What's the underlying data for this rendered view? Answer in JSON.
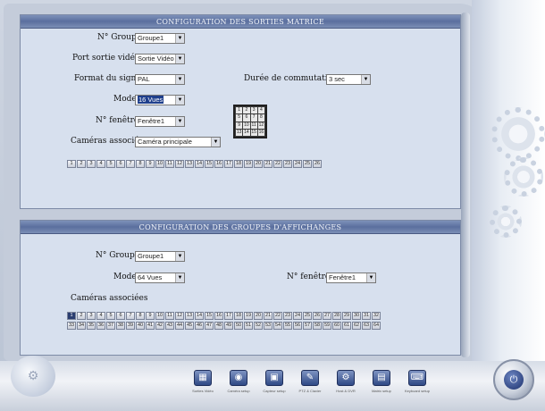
{
  "matrix": {
    "title": "CONFIGURATION DES SORTIES MATRICE",
    "groupe_label": "N° Groupe",
    "groupe_value": "Groupe1",
    "port_label": "Port sortie vidéo",
    "port_value": "Sortie Vidéo",
    "format_label": "Format du signal",
    "format_value": "PAL",
    "duree_label": "Durée de commutation",
    "duree_value": "3 sec",
    "mode_label": "Mode",
    "mode_value": "16 Vues",
    "fenetre_label": "N° fenêtre",
    "fenetre_value": "Fenêtre1",
    "cameras_label": "Caméras associées",
    "cameras_value": "Caméra principale",
    "camera_numbers": [
      "1",
      "2",
      "3",
      "4",
      "5",
      "6",
      "7",
      "8",
      "9",
      "10",
      "11",
      "12",
      "13",
      "14",
      "15",
      "16",
      "17",
      "18",
      "19",
      "20",
      "21",
      "22",
      "23",
      "24",
      "25",
      "26"
    ],
    "layout_cells": [
      "1",
      "2",
      "3",
      "4",
      "5",
      "6",
      "7",
      "8",
      "9",
      "10",
      "11",
      "12",
      "13",
      "14",
      "15",
      "16"
    ]
  },
  "groups": {
    "title": "CONFIGURATION DES GROUPES D'AFFICHANGES",
    "groupe_label": "N° Groupe",
    "groupe_value": "Groupe1",
    "mode_label": "Mode",
    "mode_value": "64 Vues",
    "fenetre_label": "N° fenêtre",
    "fenetre_value": "Fenêtre1",
    "cameras_label": "Caméras associées",
    "row1": [
      "1",
      "2",
      "3",
      "4",
      "5",
      "6",
      "7",
      "8",
      "9",
      "10",
      "11",
      "12",
      "13",
      "14",
      "15",
      "16",
      "17",
      "18",
      "19",
      "20",
      "21",
      "22",
      "23",
      "24",
      "25",
      "26",
      "27",
      "28",
      "29",
      "30",
      "31",
      "32"
    ],
    "row2": [
      "33",
      "34",
      "35",
      "36",
      "37",
      "38",
      "39",
      "40",
      "41",
      "42",
      "43",
      "44",
      "45",
      "46",
      "47",
      "48",
      "49",
      "50",
      "51",
      "52",
      "53",
      "54",
      "55",
      "56",
      "57",
      "58",
      "59",
      "60",
      "61",
      "62",
      "63",
      "64"
    ]
  },
  "toolbar": {
    "items": [
      {
        "icon": "matrix-icon",
        "label": "Sorties Vidéo"
      },
      {
        "icon": "camera-icon",
        "label": "Caméra setup"
      },
      {
        "icon": "sensor-icon",
        "label": "Capteur setup"
      },
      {
        "icon": "ptz-icon",
        "label": "PTZ & Clavier"
      },
      {
        "icon": "network-icon",
        "label": "Host & DVR"
      },
      {
        "icon": "system-icon",
        "label": "Matrix setup"
      },
      {
        "icon": "keyboard-icon",
        "label": "Keyboard setup"
      }
    ]
  },
  "colors": {
    "panel_header": "#5b6f9e",
    "panel_body": "#d7e0ee",
    "selected_cell": "#2a3d70"
  }
}
